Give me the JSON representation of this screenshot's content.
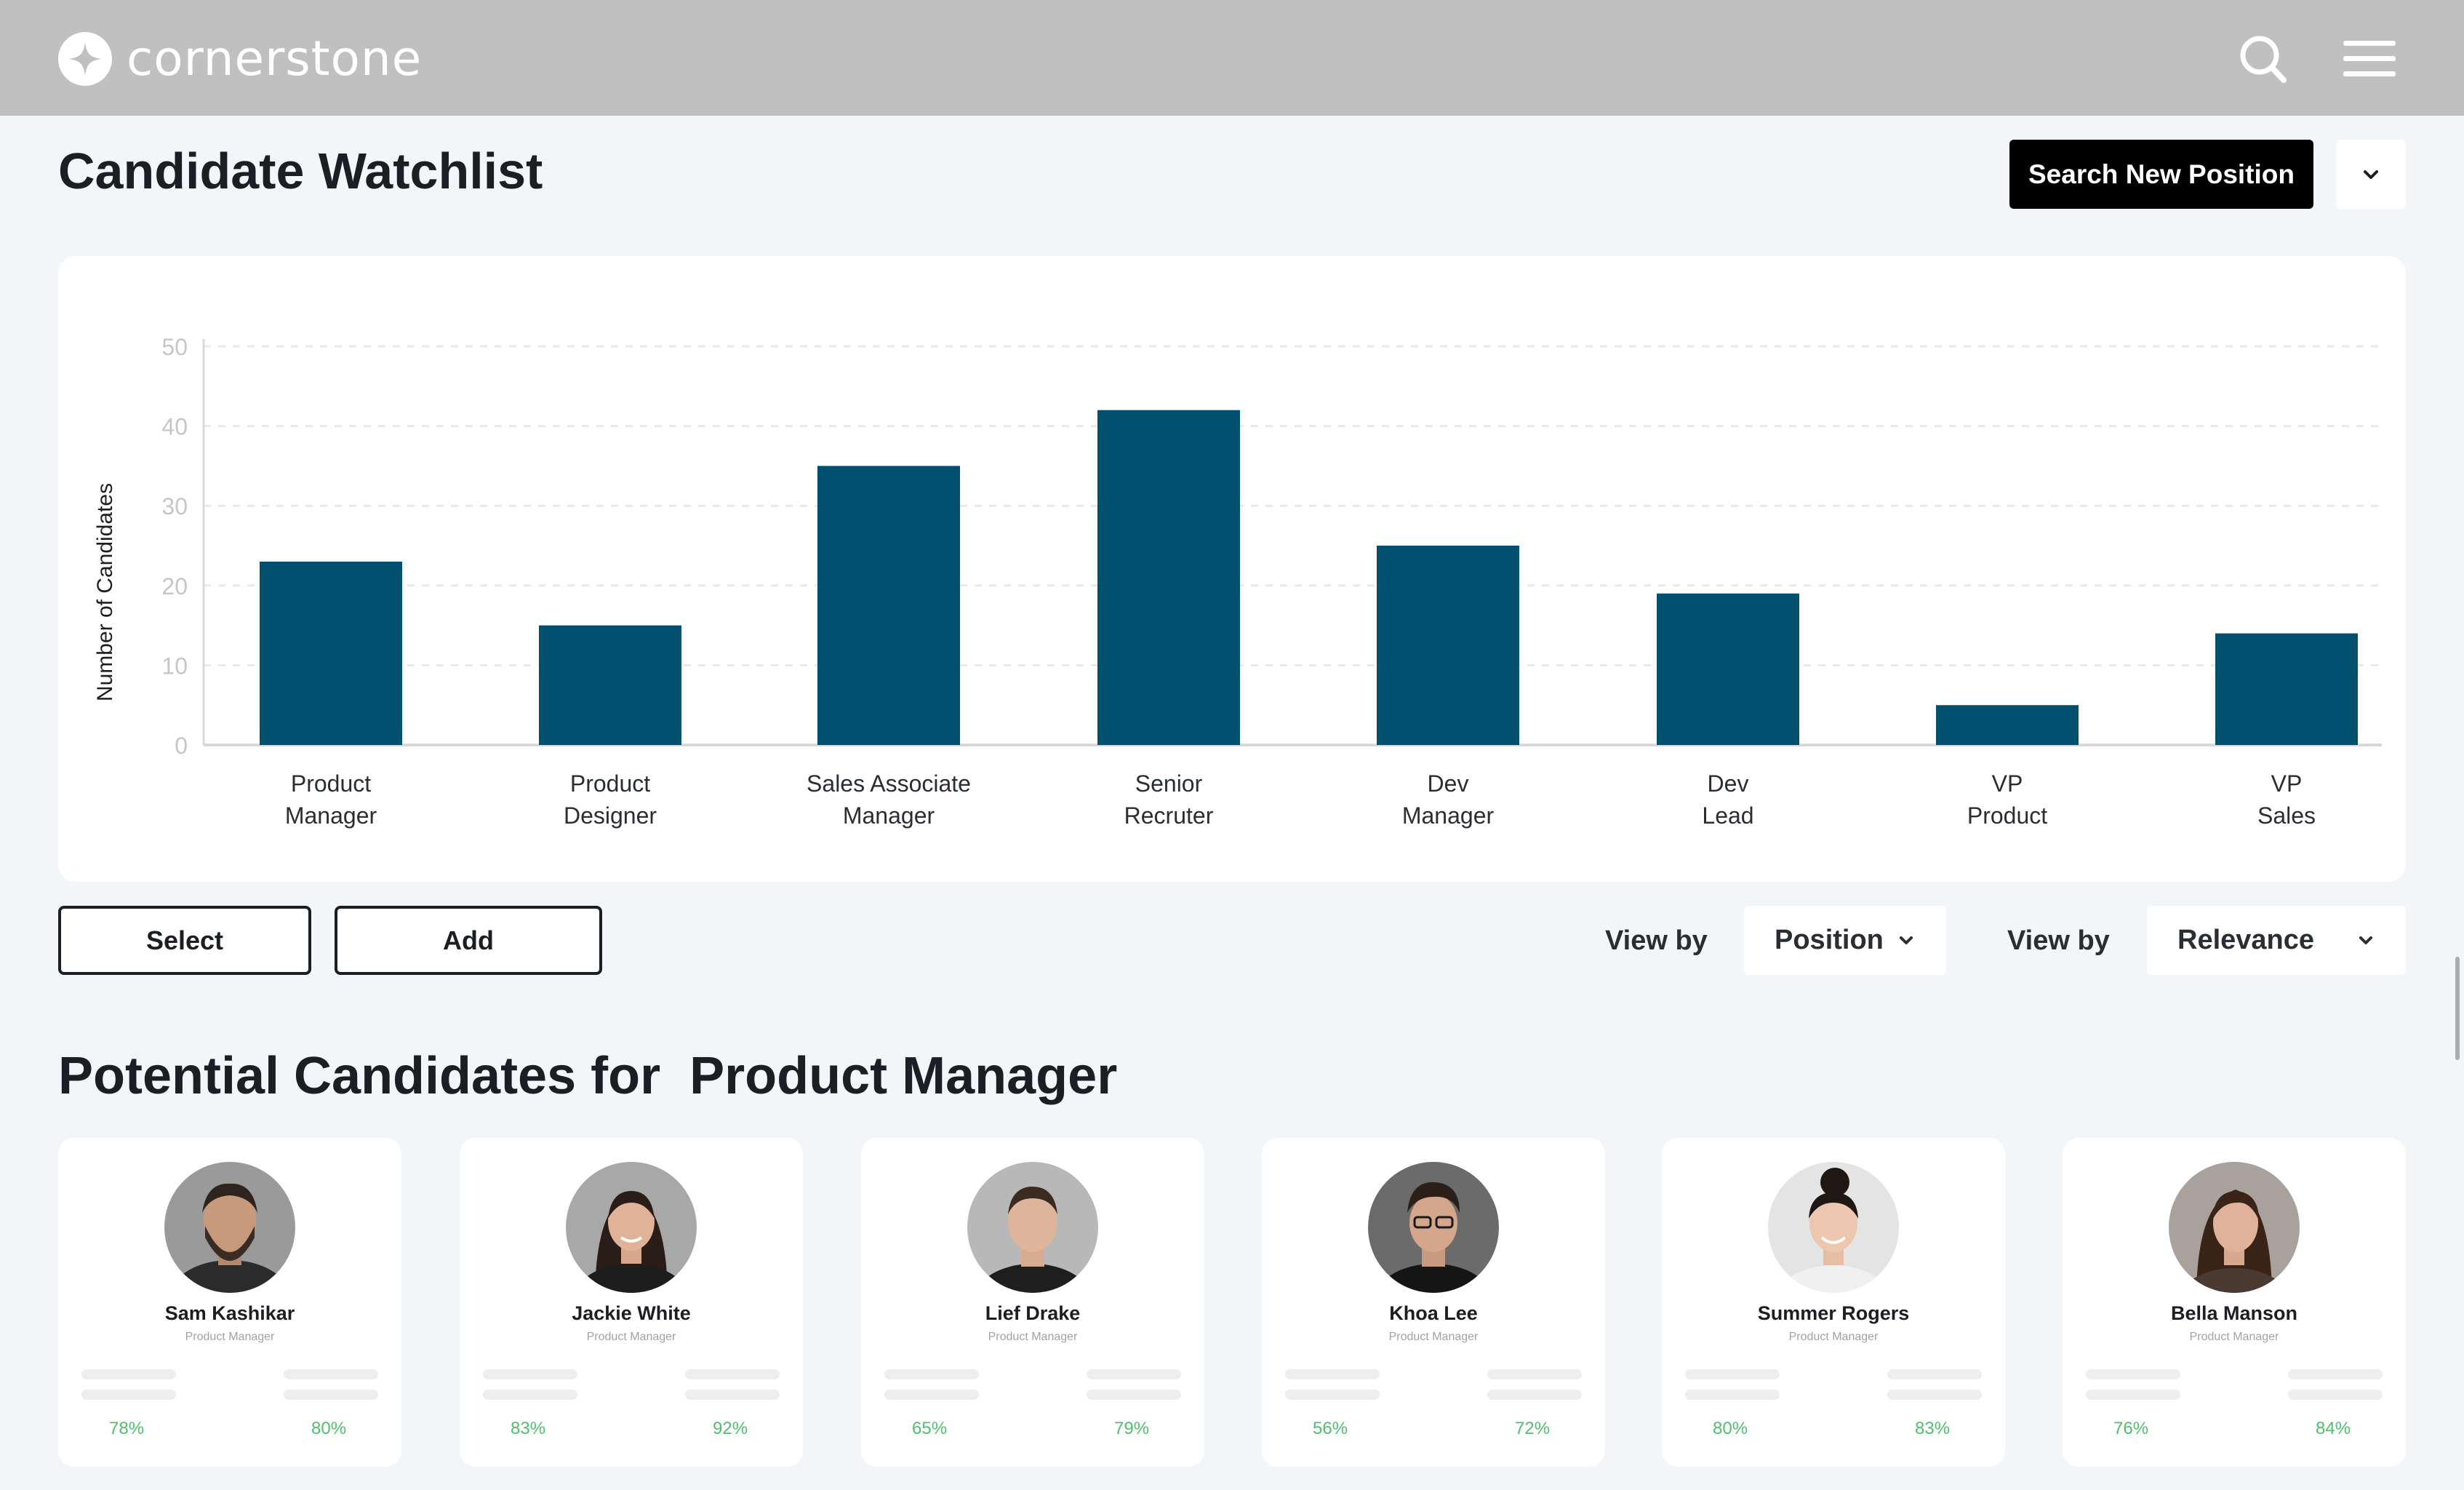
{
  "header": {
    "brand": "cornerstone",
    "icons": [
      "logo-mark-icon",
      "search-icon",
      "hamburger-menu-icon"
    ]
  },
  "page": {
    "title": "Candidate Watchlist",
    "search_button": "Search New Position"
  },
  "chart_data": {
    "type": "bar",
    "ylabel": "Number of Candidates",
    "xlabel": "",
    "ylim": [
      0,
      50
    ],
    "yticks": [
      0,
      10,
      20,
      30,
      40,
      50
    ],
    "grid": true,
    "bar_color": "#02506f",
    "categories": [
      [
        "Product",
        "Manager"
      ],
      [
        "Product",
        "Designer"
      ],
      [
        "Sales Associate",
        "Manager"
      ],
      [
        "Senior",
        "Recruter"
      ],
      [
        "Dev",
        "Manager"
      ],
      [
        "Dev",
        "Lead"
      ],
      [
        "VP",
        "Product"
      ],
      [
        "VP",
        "Sales"
      ]
    ],
    "values": [
      23,
      15,
      35,
      42,
      25,
      19,
      5,
      14
    ]
  },
  "controls": {
    "select_label": "Select",
    "add_label": "Add",
    "viewby1_label": "View by",
    "viewby1_value": "Position",
    "viewby2_label": "View by",
    "viewby2_value": "Relevance"
  },
  "candidates_section": {
    "title": "Potential Candidates for  Product Manager",
    "accent_color": "#4fc06d",
    "cards": [
      {
        "name": "Sam Kashikar",
        "role": "Product Manager",
        "left_pct": "78%",
        "right_pct": "80%"
      },
      {
        "name": "Jackie White",
        "role": "Product Manager",
        "left_pct": "83%",
        "right_pct": "92%"
      },
      {
        "name": "Lief Drake",
        "role": "Product Manager",
        "left_pct": "65%",
        "right_pct": "79%"
      },
      {
        "name": "Khoa Lee",
        "role": "Product Manager",
        "left_pct": "56%",
        "right_pct": "72%"
      },
      {
        "name": "Summer Rogers",
        "role": "Product Manager",
        "left_pct": "80%",
        "right_pct": "83%"
      },
      {
        "name": "Bella Manson",
        "role": "Product Manager",
        "left_pct": "76%",
        "right_pct": "84%"
      }
    ]
  }
}
